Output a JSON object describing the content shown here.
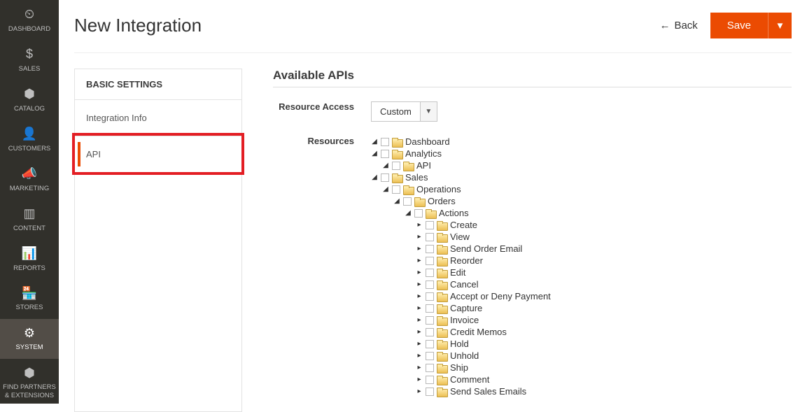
{
  "sidebar": {
    "items": [
      {
        "label": "DASHBOARD",
        "icon": "⏲"
      },
      {
        "label": "SALES",
        "icon": "$"
      },
      {
        "label": "CATALOG",
        "icon": "⬢"
      },
      {
        "label": "CUSTOMERS",
        "icon": "👤"
      },
      {
        "label": "MARKETING",
        "icon": "📣"
      },
      {
        "label": "CONTENT",
        "icon": "▥"
      },
      {
        "label": "REPORTS",
        "icon": "📊"
      },
      {
        "label": "STORES",
        "icon": "🏪"
      },
      {
        "label": "SYSTEM",
        "icon": "⚙"
      },
      {
        "label": "FIND PARTNERS & EXTENSIONS",
        "icon": "⬢"
      }
    ],
    "active_index": 8
  },
  "page": {
    "title": "New Integration",
    "back_label": "Back",
    "save_label": "Save"
  },
  "settings": {
    "header": "BASIC SETTINGS",
    "items": [
      "Integration Info",
      "API"
    ],
    "selected_index": 1
  },
  "api": {
    "section_title": "Available APIs",
    "resource_access_label": "Resource Access",
    "resource_access_value": "Custom",
    "resources_label": "Resources",
    "tree": [
      {
        "label": "Dashboard",
        "toggle": "open"
      },
      {
        "label": "Analytics",
        "toggle": "open",
        "children": [
          {
            "label": "API",
            "toggle": "open"
          }
        ]
      },
      {
        "label": "Sales",
        "toggle": "open",
        "children": [
          {
            "label": "Operations",
            "toggle": "open",
            "children": [
              {
                "label": "Orders",
                "toggle": "open",
                "children": [
                  {
                    "label": "Actions",
                    "toggle": "open",
                    "children": [
                      {
                        "label": "Create",
                        "toggle": "closed"
                      },
                      {
                        "label": "View",
                        "toggle": "closed"
                      },
                      {
                        "label": "Send Order Email",
                        "toggle": "closed"
                      },
                      {
                        "label": "Reorder",
                        "toggle": "closed"
                      },
                      {
                        "label": "Edit",
                        "toggle": "closed"
                      },
                      {
                        "label": "Cancel",
                        "toggle": "closed"
                      },
                      {
                        "label": "Accept or Deny Payment",
                        "toggle": "closed"
                      },
                      {
                        "label": "Capture",
                        "toggle": "closed"
                      },
                      {
                        "label": "Invoice",
                        "toggle": "closed"
                      },
                      {
                        "label": "Credit Memos",
                        "toggle": "closed"
                      },
                      {
                        "label": "Hold",
                        "toggle": "closed"
                      },
                      {
                        "label": "Unhold",
                        "toggle": "closed"
                      },
                      {
                        "label": "Ship",
                        "toggle": "closed"
                      },
                      {
                        "label": "Comment",
                        "toggle": "closed"
                      },
                      {
                        "label": "Send Sales Emails",
                        "toggle": "closed"
                      }
                    ]
                  }
                ]
              }
            ]
          }
        ]
      }
    ]
  }
}
